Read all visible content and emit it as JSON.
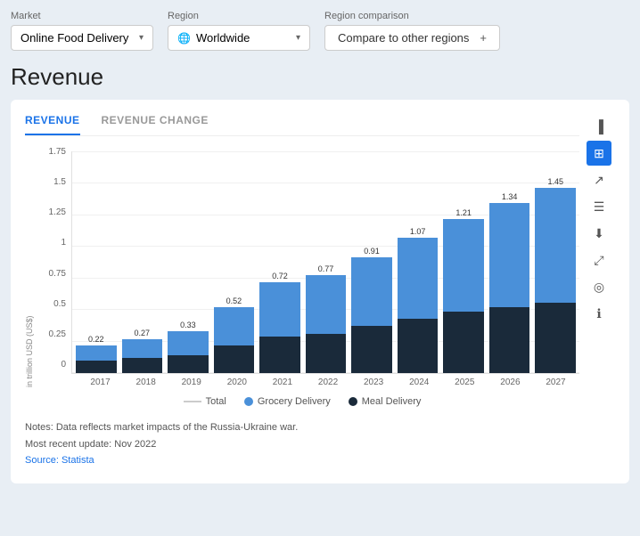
{
  "filters": {
    "market_label": "Market",
    "market_value": "Online Food Delivery",
    "region_label": "Region",
    "region_value": "Worldwide",
    "comparison_label": "Region comparison",
    "comparison_value": "Compare to other regions",
    "comparison_plus": "+"
  },
  "page": {
    "title": "Revenue"
  },
  "tabs": [
    {
      "id": "revenue",
      "label": "REVENUE",
      "active": true
    },
    {
      "id": "revenue-change",
      "label": "REVENUE CHANGE",
      "active": false
    }
  ],
  "chart": {
    "y_axis_label": "in trillion USD (US$)",
    "y_ticks": [
      "1.75",
      "1.5",
      "1.25",
      "1",
      "0.75",
      "0.5",
      "0.25",
      "0"
    ],
    "bars": [
      {
        "year": "2017",
        "total": 0.22,
        "grocery": 0.12,
        "meal": 0.1,
        "label": "0.22"
      },
      {
        "year": "2018",
        "total": 0.27,
        "grocery": 0.15,
        "meal": 0.12,
        "label": "0.27"
      },
      {
        "year": "2019",
        "total": 0.33,
        "grocery": 0.19,
        "meal": 0.14,
        "label": "0.33"
      },
      {
        "year": "2020",
        "total": 0.52,
        "grocery": 0.3,
        "meal": 0.22,
        "label": "0.52"
      },
      {
        "year": "2021",
        "total": 0.72,
        "grocery": 0.43,
        "meal": 0.29,
        "label": "0.72"
      },
      {
        "year": "2022",
        "total": 0.77,
        "grocery": 0.46,
        "meal": 0.31,
        "label": "0.77"
      },
      {
        "year": "2023",
        "total": 0.91,
        "grocery": 0.54,
        "meal": 0.37,
        "label": "0.91"
      },
      {
        "year": "2024",
        "total": 1.07,
        "grocery": 0.64,
        "meal": 0.43,
        "label": "1.07"
      },
      {
        "year": "2025",
        "total": 1.21,
        "grocery": 0.73,
        "meal": 0.48,
        "label": "1.21"
      },
      {
        "year": "2026",
        "total": 1.34,
        "grocery": 0.82,
        "meal": 0.52,
        "label": "1.34"
      },
      {
        "year": "2027",
        "total": 1.45,
        "grocery": 0.9,
        "meal": 0.55,
        "label": "1.45"
      }
    ],
    "max_value": 1.75,
    "legend": [
      {
        "id": "total",
        "label": "Total",
        "type": "line",
        "color": "#ccc"
      },
      {
        "id": "grocery",
        "label": "Grocery Delivery",
        "type": "dot",
        "color": "#4a90d9"
      },
      {
        "id": "meal",
        "label": "Meal Delivery",
        "type": "dot",
        "color": "#1a2a3a"
      }
    ]
  },
  "notes": {
    "line1": "Notes: Data reflects market impacts of the Russia-Ukraine war.",
    "line2": "Most recent update: Nov 2022",
    "line3": "Source: Statista"
  },
  "sidebar_icons": [
    {
      "id": "bar-chart",
      "symbol": "▐",
      "active": false
    },
    {
      "id": "grid-chart",
      "symbol": "⊞",
      "active": true
    },
    {
      "id": "trend",
      "symbol": "↗",
      "active": false
    },
    {
      "id": "table",
      "symbol": "≡",
      "active": false
    },
    {
      "id": "download",
      "symbol": "⬇",
      "active": false
    },
    {
      "id": "expand",
      "symbol": "⤢",
      "active": false
    },
    {
      "id": "hide",
      "symbol": "◎",
      "active": false
    },
    {
      "id": "info",
      "symbol": "ℹ",
      "active": false
    }
  ]
}
